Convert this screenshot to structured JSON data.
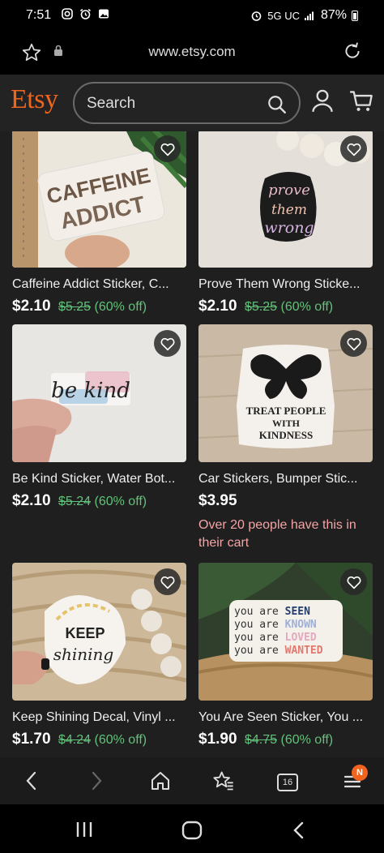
{
  "status": {
    "time": "7:51",
    "left_icons": [
      "instagram-icon",
      "alarm-icon",
      "gallery-icon"
    ],
    "network": "5G UC",
    "battery": "87%"
  },
  "browser": {
    "url": "www.etsy.com",
    "tabs_count": "16",
    "menu_badge": "N"
  },
  "header": {
    "logo": "Etsy",
    "search_placeholder": "Search"
  },
  "listings": [
    {
      "title": "Caffeine Addict Sticker, C...",
      "price": "$2.10",
      "original_price": "$5.25",
      "discount": "(60% off)",
      "image_text": "CAFFEINE ADDICT"
    },
    {
      "title": "Prove Them Wrong Sticke...",
      "price": "$2.10",
      "original_price": "$5.25",
      "discount": "(60% off)",
      "image_text": "prove them wrong"
    },
    {
      "title": "Be Kind Sticker, Water Bot...",
      "price": "$2.10",
      "original_price": "$5.24",
      "discount": "(60% off)",
      "image_text": "be kind"
    },
    {
      "title": "Car Stickers, Bumper Stic...",
      "price": "$3.95",
      "original_price": "",
      "discount": "",
      "note": "Over 20 people have this in their cart",
      "image_text": "TREAT PEOPLE WITH KINDNESS"
    },
    {
      "title": "Keep Shining Decal, Vinyl ...",
      "price": "$1.70",
      "original_price": "$4.24",
      "discount": "(60% off)",
      "image_text": "KEEP shining"
    },
    {
      "title": "You Are Seen Sticker, You ...",
      "price": "$1.90",
      "original_price": "$4.75",
      "discount": "(60% off)",
      "image_text": [
        "you are SEEN",
        "you are KNOWN",
        "you are LOVED",
        "you are WANTED"
      ]
    }
  ],
  "colors": {
    "brand": "#f1641e",
    "sale": "#62c27a",
    "note": "#f4a4a4",
    "header_bg": "#232323"
  }
}
